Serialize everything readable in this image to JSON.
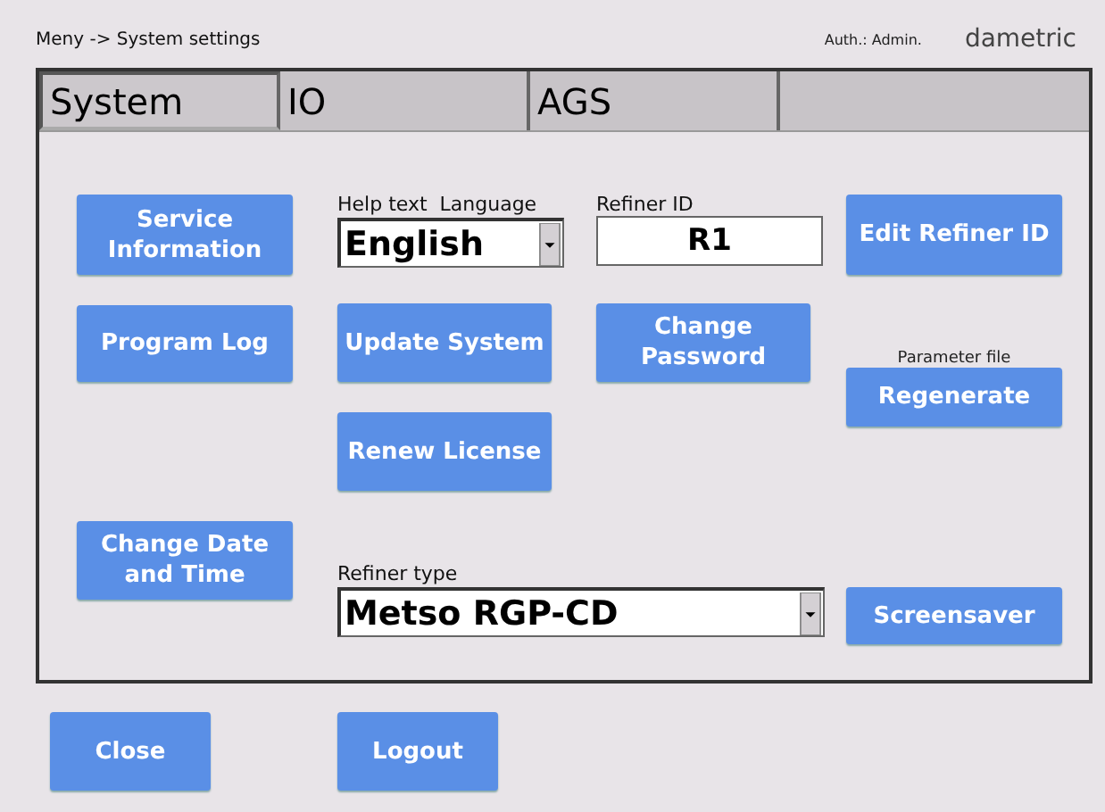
{
  "header": {
    "breadcrumb": "Meny -> System settings",
    "auth": "Auth.: Admin.",
    "logo": "dametric"
  },
  "tabs": [
    {
      "label": "System",
      "selected": true
    },
    {
      "label": "IO",
      "selected": false
    },
    {
      "label": "AGS",
      "selected": false
    }
  ],
  "column_1": {
    "service_information": "Service Information",
    "program_log": "Program Log",
    "change_date_time": "Change Date and Time"
  },
  "help_language": {
    "label": "Help text  Language",
    "value": "English"
  },
  "update_system": "Update System",
  "renew_license": "Renew License",
  "refiner_id": {
    "label": "Refiner ID",
    "value": "R1"
  },
  "change_password": "Change Password",
  "edit_refiner_id": "Edit Refiner ID",
  "parameter_file": {
    "label": "Parameter file",
    "button": "Regenerate"
  },
  "refiner_type": {
    "label": "Refiner type",
    "value": "Metso RGP-CD"
  },
  "screensaver": "Screensaver",
  "footer_buttons": [
    "Close",
    "Logout"
  ]
}
